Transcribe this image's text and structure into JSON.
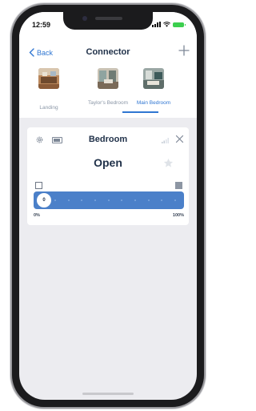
{
  "status_bar": {
    "time": "12:59"
  },
  "nav": {
    "back_label": "Back",
    "title": "Connector"
  },
  "tabs": [
    {
      "label": "Landing",
      "active": false,
      "icon": "room-photo"
    },
    {
      "label": "Taylor's Bedroom",
      "active": false,
      "icon": "room-photo"
    },
    {
      "label": "Main Bedroom",
      "active": true,
      "icon": "room-photo"
    }
  ],
  "device_card": {
    "title": "Bedroom",
    "status": "Open",
    "position_percent": 0,
    "position_label": "0",
    "scale_min": "0%",
    "scale_max": "100%"
  },
  "colors": {
    "accent": "#2f76d2",
    "slider_track": "#4b80c9",
    "battery_green": "#3ccf4e",
    "title_text": "#21324a"
  }
}
